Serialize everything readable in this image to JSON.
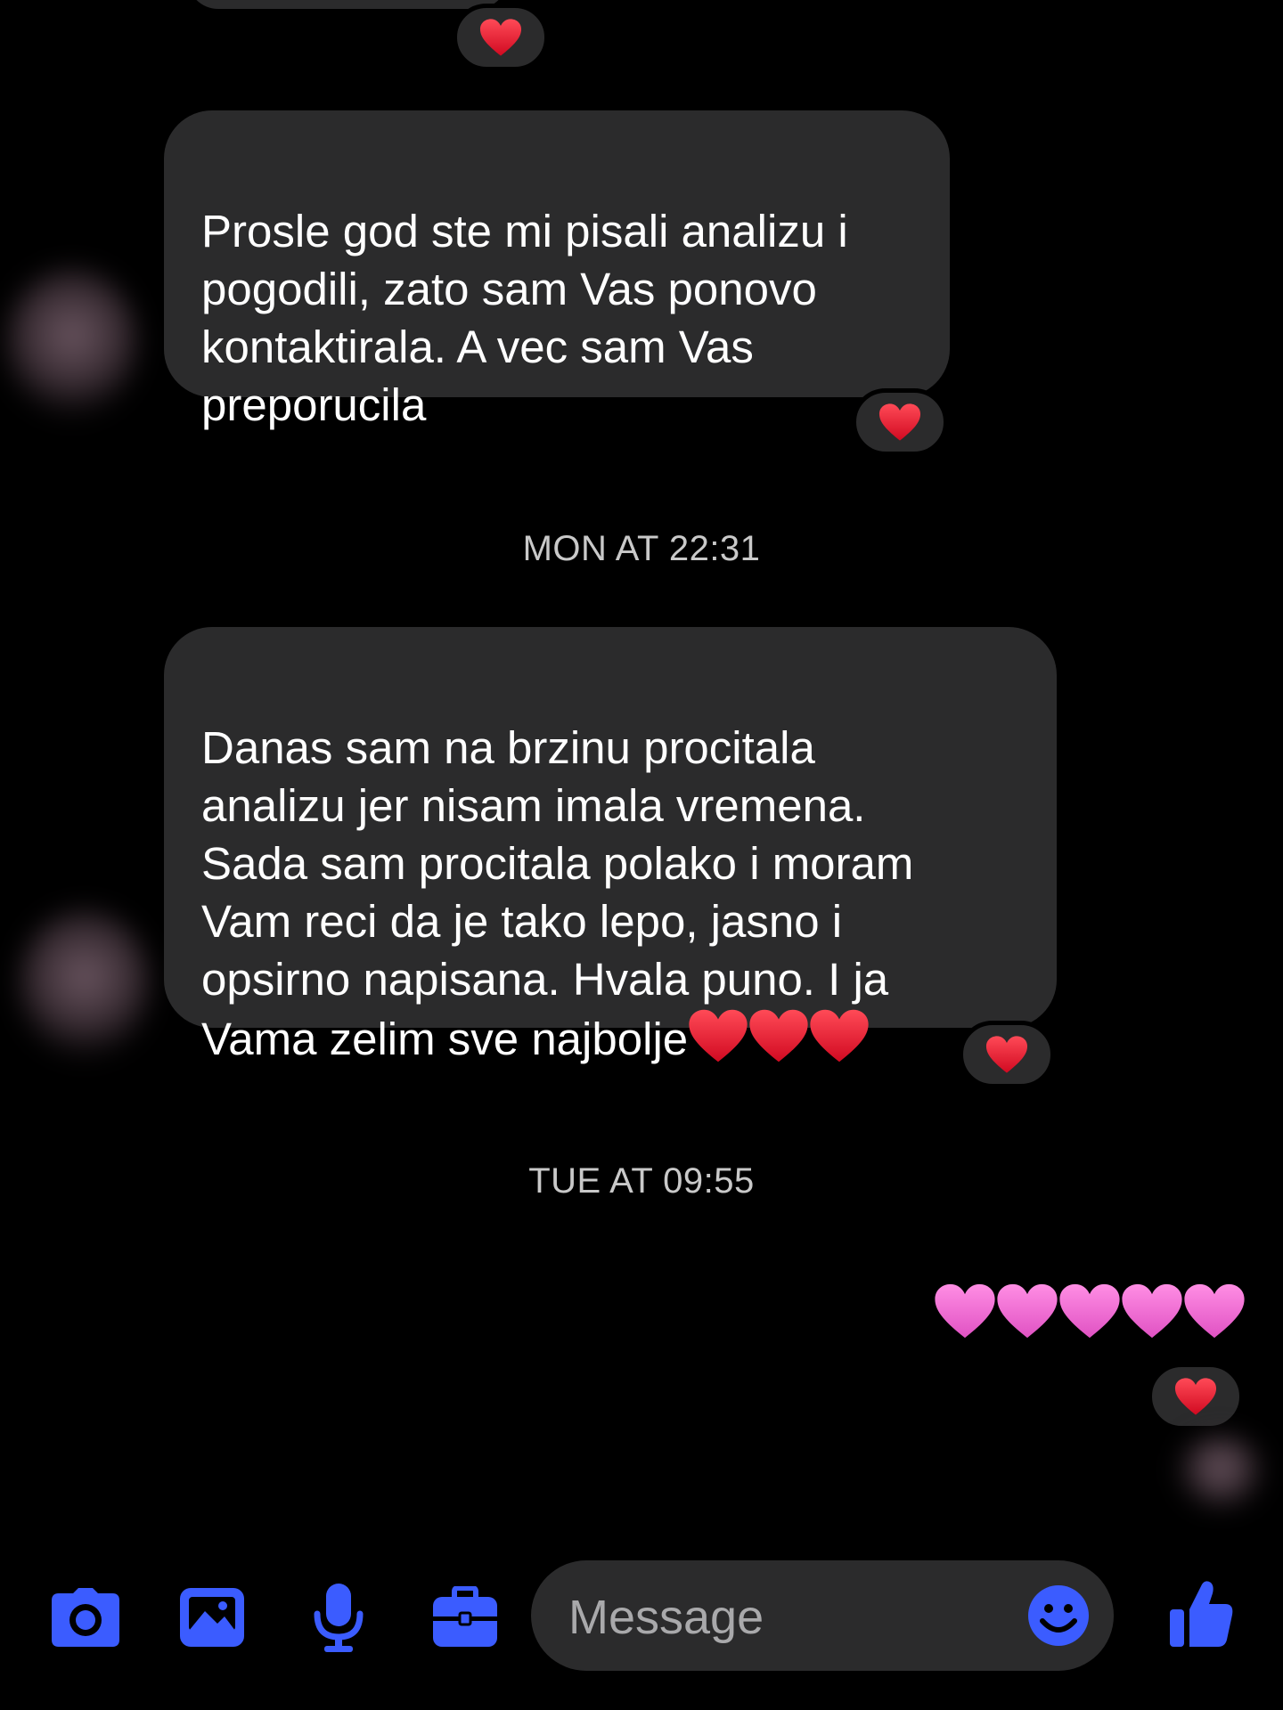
{
  "conversation": {
    "messages": [
      {
        "text": "Prosle god ste mi pisali analizu i\npogodili, zato sam Vas ponovo\nkontaktirala. A vec sam Vas\npreporucila",
        "reaction": "red-heart"
      },
      {
        "text": "Danas sam na brzinu procitala\nanalizu jer nisam imala vremena.\nSada sam procitala polako i moram\nVam reci da je tako lepo, jasno i\nopsirno napisana. Hvala puno. I ja\nVama zelim sve najbolje",
        "trailing_emoji": [
          "red-heart",
          "red-heart",
          "red-heart"
        ],
        "reaction": "red-heart"
      }
    ],
    "timestamps": [
      "MON AT 22:31",
      "TUE AT 09:55"
    ],
    "sent": {
      "emoji": [
        "pink-heart",
        "pink-heart",
        "pink-heart",
        "pink-heart",
        "pink-heart"
      ],
      "reaction": "red-heart"
    }
  },
  "composer": {
    "placeholder": "Message",
    "icons": [
      "camera-icon",
      "image-icon",
      "microphone-icon",
      "briefcase-icon",
      "emoji-icon",
      "thumbs-up-icon"
    ]
  },
  "colors": {
    "background": "#000000",
    "bubble": "#2b2b2c",
    "accent": "#3b5cff",
    "heart_red": "#e8112d",
    "heart_pink": "#f06cd1"
  }
}
